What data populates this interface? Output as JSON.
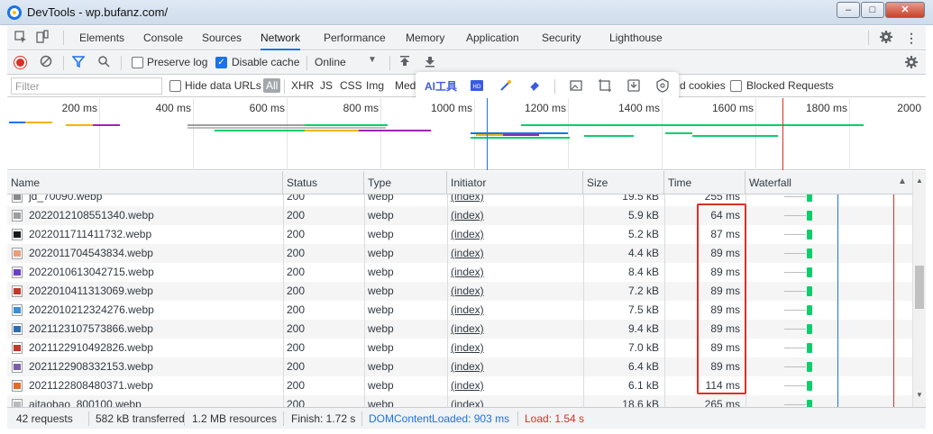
{
  "window": {
    "title": "DevTools - wp.bufanz.com/",
    "min_label": "–",
    "max_label": "□",
    "close_label": "✕"
  },
  "tabs": [
    {
      "label": "Elements",
      "active": false
    },
    {
      "label": "Console",
      "active": false
    },
    {
      "label": "Sources",
      "active": false
    },
    {
      "label": "Network",
      "active": true
    },
    {
      "label": "Performance",
      "active": false
    },
    {
      "label": "Memory",
      "active": false
    },
    {
      "label": "Application",
      "active": false
    },
    {
      "label": "Security",
      "active": false
    },
    {
      "label": "Lighthouse",
      "active": false
    }
  ],
  "toolbar": {
    "preserve_log": {
      "label": "Preserve log",
      "checked": false
    },
    "disable_cache": {
      "label": "Disable cache",
      "checked": true
    },
    "throttling": "Online"
  },
  "filterbar": {
    "filter_placeholder": "Filter",
    "hide_data_urls": "Hide data URLs",
    "types": [
      "All",
      "XHR",
      "JS",
      "CSS",
      "Img",
      "Med"
    ],
    "blocked_cookies_partial": "d cookies",
    "blocked_requests": "Blocked Requests"
  },
  "floatbar": {
    "ai_label": "AI工具"
  },
  "overview": {
    "ticks": [
      "200 ms",
      "400 ms",
      "600 ms",
      "800 ms",
      "1000 ms",
      "1200 ms",
      "1400 ms",
      "1600 ms",
      "1800 ms",
      "2000"
    ]
  },
  "columns": [
    "Name",
    "Status",
    "Type",
    "Initiator",
    "Size",
    "Time",
    "Waterfall"
  ],
  "rows": [
    {
      "name": "jd_70090.webp",
      "status": "200",
      "type": "webp",
      "initiator": "(index)",
      "size": "19.5 kB",
      "time": "255 ms",
      "thumb": "#888888",
      "partial": "top"
    },
    {
      "name": "2022012108551340.webp",
      "status": "200",
      "type": "webp",
      "initiator": "(index)",
      "size": "5.9 kB",
      "time": "64 ms",
      "thumb": "#9e9e9e"
    },
    {
      "name": "2022011711411732.webp",
      "status": "200",
      "type": "webp",
      "initiator": "(index)",
      "size": "5.2 kB",
      "time": "87 ms",
      "thumb": "#1a1a1a"
    },
    {
      "name": "2022011704543834.webp",
      "status": "200",
      "type": "webp",
      "initiator": "(index)",
      "size": "4.4 kB",
      "time": "89 ms",
      "thumb": "#e8a07a"
    },
    {
      "name": "2022010613042715.webp",
      "status": "200",
      "type": "webp",
      "initiator": "(index)",
      "size": "8.4 kB",
      "time": "89 ms",
      "thumb": "#6a3fc8"
    },
    {
      "name": "2022010411313069.webp",
      "status": "200",
      "type": "webp",
      "initiator": "(index)",
      "size": "7.2 kB",
      "time": "89 ms",
      "thumb": "#c0392b"
    },
    {
      "name": "2022010212324276.webp",
      "status": "200",
      "type": "webp",
      "initiator": "(index)",
      "size": "7.5 kB",
      "time": "89 ms",
      "thumb": "#3b8ed8"
    },
    {
      "name": "2021123107573866.webp",
      "status": "200",
      "type": "webp",
      "initiator": "(index)",
      "size": "9.4 kB",
      "time": "89 ms",
      "thumb": "#2b6cb0"
    },
    {
      "name": "2021122910492826.webp",
      "status": "200",
      "type": "webp",
      "initiator": "(index)",
      "size": "7.0 kB",
      "time": "89 ms",
      "thumb": "#c0392b"
    },
    {
      "name": "2021122908332153.webp",
      "status": "200",
      "type": "webp",
      "initiator": "(index)",
      "size": "6.4 kB",
      "time": "89 ms",
      "thumb": "#7b5ea7"
    },
    {
      "name": "2021122808480371.webp",
      "status": "200",
      "type": "webp",
      "initiator": "(index)",
      "size": "6.1 kB",
      "time": "114 ms",
      "thumb": "#e26b2a"
    },
    {
      "name": "aitaobao_800100.webp",
      "status": "200",
      "type": "webp",
      "initiator": "(index)",
      "size": "18.6 kB",
      "time": "265 ms",
      "thumb": "#bbbbbb",
      "partial": "bottom"
    }
  ],
  "status": {
    "requests": "42 requests",
    "transferred": "582 kB transferred",
    "resources": "1.2 MB resources",
    "finish": "Finish: 1.72 s",
    "dom_content_loaded": "DOMContentLoaded: 903 ms",
    "load": "Load: 1.54 s"
  },
  "colors": {
    "accent": "#1a73e8",
    "record": "#d93025",
    "waterfall_bar": "#0cce6b",
    "highlight": "#d93025"
  }
}
